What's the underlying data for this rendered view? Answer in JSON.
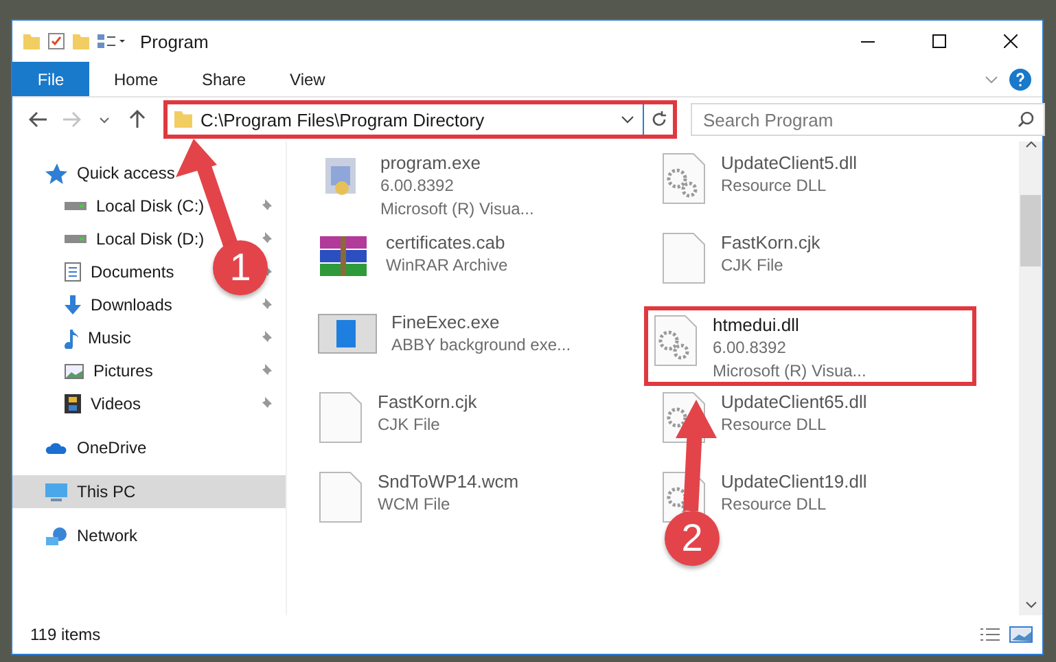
{
  "window": {
    "title": "Program"
  },
  "ribbon_tabs": [
    {
      "label": "File",
      "kind": "file"
    },
    {
      "label": "Home",
      "kind": "tab"
    },
    {
      "label": "Share",
      "kind": "tab"
    },
    {
      "label": "View",
      "kind": "tab"
    }
  ],
  "address": {
    "path": "C:\\Program Files\\Program Directory",
    "highlighted": true
  },
  "search": {
    "placeholder": "Search Program"
  },
  "nav": [
    {
      "label": "Quick access",
      "kind": "star",
      "selected": false,
      "children": [
        {
          "label": "Local Disk (C:)",
          "kind": "drive",
          "pinned": true
        },
        {
          "label": "Local Disk (D:)",
          "kind": "drive",
          "pinned": true
        },
        {
          "label": "Documents",
          "kind": "document",
          "pinned": true
        },
        {
          "label": "Downloads",
          "kind": "download",
          "pinned": true
        },
        {
          "label": "Music",
          "kind": "music",
          "pinned": true
        },
        {
          "label": "Pictures",
          "kind": "pictures",
          "pinned": true
        },
        {
          "label": "Videos",
          "kind": "video",
          "pinned": true
        }
      ]
    },
    {
      "label": "OneDrive",
      "kind": "cloud",
      "selected": false
    },
    {
      "label": "This PC",
      "kind": "monitor",
      "selected": true
    },
    {
      "label": "Network",
      "kind": "network",
      "selected": false
    }
  ],
  "files": [
    {
      "name": "program.exe",
      "line_2": "6.00.8392",
      "line_3": "Microsoft (R) Visua...",
      "kind": "app",
      "highlighted": false
    },
    {
      "name": "UpdateClient5.dll",
      "line_2": "Resource DLL",
      "kind": "gears",
      "highlighted": false
    },
    {
      "name": "certificates.cab",
      "line_2": "WinRAR Archive",
      "kind": "archive",
      "highlighted": false
    },
    {
      "name": "FastKorn.cjk",
      "line_2": "CJK File",
      "kind": "blank",
      "highlighted": false
    },
    {
      "name": "FineExec.exe",
      "line_2": "ABBY background exe...",
      "kind": "window",
      "highlighted": false
    },
    {
      "name": "htmedui.dll",
      "line_2": "6.00.8392",
      "line_3": "Microsoft (R) Visua...",
      "kind": "gears",
      "highlighted": true
    },
    {
      "name": "FastKorn.cjk",
      "line_2": "CJK File",
      "kind": "blank",
      "highlighted": false
    },
    {
      "name": "UpdateClient65.dll",
      "line_2": "Resource DLL",
      "kind": "gears",
      "highlighted": false
    },
    {
      "name": "SndToWP14.wcm",
      "line_2": "WCM File",
      "kind": "blank",
      "highlighted": false
    },
    {
      "name": "UpdateClient19.dll",
      "line_2": "Resource DLL",
      "kind": "gears",
      "highlighted": false
    }
  ],
  "status_bar": {
    "count": "119 items"
  },
  "annotations": [
    {
      "number": "1"
    },
    {
      "number": "2"
    }
  ]
}
